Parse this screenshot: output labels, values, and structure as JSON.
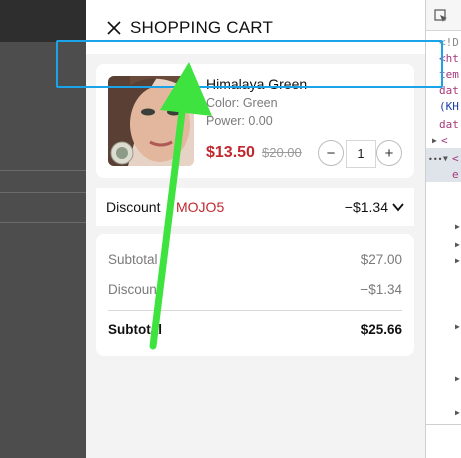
{
  "drawer": {
    "title": "SHOPPING CART"
  },
  "product": {
    "name": "Himalaya Green",
    "color": "Color: Green",
    "power": "Power: 0.00",
    "price": "$13.50",
    "old_price": "$20.00",
    "quantity": "1",
    "minus": "−",
    "plus": "+"
  },
  "discount": {
    "label": "Discount",
    "code": "MOJO5",
    "amount": "−$1.34"
  },
  "summary": {
    "subtotal_label": "Subtotal",
    "subtotal_value": "$27.00",
    "discount_label": "Discount",
    "discount_value": "−$1.34",
    "total_label": "Subtotal",
    "total_value": "$25.66"
  },
  "devtools": {
    "lines": [
      "<!D",
      "<ht",
      "tem",
      "dat",
      "(KH",
      "dat",
      "<",
      "<",
      "e"
    ]
  },
  "colors": {
    "accent_red": "#c0282e",
    "highlight_blue": "#1aa3e8",
    "arrow_green": "#3fe33f"
  }
}
